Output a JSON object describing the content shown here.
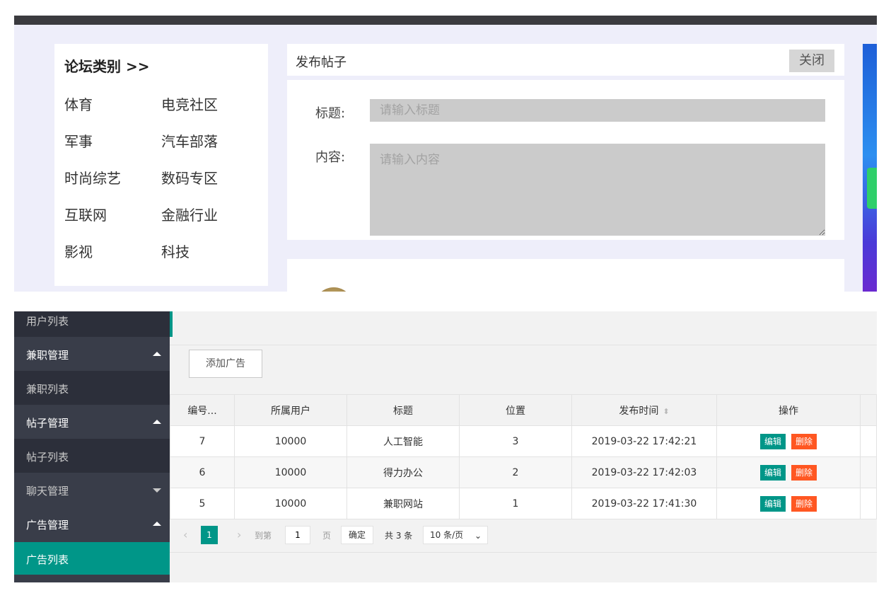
{
  "forum": {
    "category_title": "论坛类别 >>",
    "categories": [
      "体育",
      "电竞社区",
      "军事",
      "汽车部落",
      "时尚综艺",
      "数码专区",
      "互联网",
      "金融行业",
      "影视",
      "科技"
    ],
    "post_panel_title": "发布帖子",
    "close_label": "关闭",
    "title_label": "标题:",
    "title_placeholder": "请输入标题",
    "content_label": "内容:",
    "content_placeholder": "请输入内容"
  },
  "admin": {
    "sidebar": {
      "items": [
        {
          "label": "用户列表",
          "type": "sub"
        },
        {
          "label": "兼职管理",
          "type": "group",
          "expanded": true
        },
        {
          "label": "兼职列表",
          "type": "sub"
        },
        {
          "label": "帖子管理",
          "type": "group",
          "expanded": true
        },
        {
          "label": "帖子列表",
          "type": "sub"
        },
        {
          "label": "聊天管理",
          "type": "group",
          "expanded": false
        },
        {
          "label": "广告管理",
          "type": "group",
          "expanded": true
        },
        {
          "label": "广告列表",
          "type": "sub",
          "active": true
        }
      ]
    },
    "add_button": "添加广告",
    "table": {
      "headers": [
        "编号...",
        "所属用户",
        "标题",
        "位置",
        "发布时间",
        "操作"
      ],
      "sort_icon": "⬍",
      "rows": [
        {
          "id": "7",
          "user": "10000",
          "title": "人工智能",
          "position": "3",
          "time": "2019-03-22 17:42:21"
        },
        {
          "id": "6",
          "user": "10000",
          "title": "得力办公",
          "position": "2",
          "time": "2019-03-22 17:42:03"
        },
        {
          "id": "5",
          "user": "10000",
          "title": "兼职网站",
          "position": "1",
          "time": "2019-03-22 17:41:30"
        }
      ],
      "edit_label": "编辑",
      "delete_label": "删除"
    },
    "pager": {
      "current_page": "1",
      "goto_label": "到第",
      "goto_value": "1",
      "page_unit": "页",
      "confirm_label": "确定",
      "total_text": "共 3 条",
      "page_size": "10 条/页"
    }
  },
  "colors": {
    "accent": "#009688",
    "danger": "#ff5722",
    "sidebar_bg": "#393d49"
  }
}
